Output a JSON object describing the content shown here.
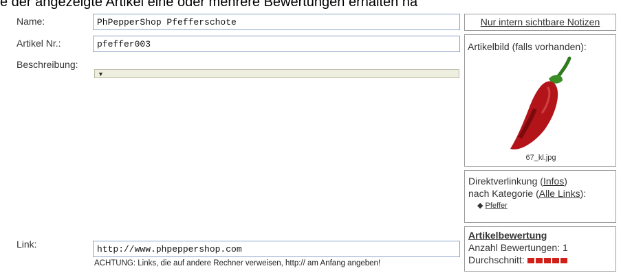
{
  "header": {
    "background_text": "e der angezeigte Artikel eine oder mehrere Bewertungen erhalten ha"
  },
  "form": {
    "name_label": "Name:",
    "name_value": "PhPepperShop Pfefferschote",
    "article_no_label": "Artikel Nr.:",
    "article_no_value": "pfeffer003",
    "description_label": "Beschreibung:",
    "link_label": "Link:",
    "link_value": "http://www.phpeppershop.com",
    "link_warning": "ACHTUNG: Links, die auf andere Rechner verweisen, http:// am Anfang angeben!"
  },
  "sidebar": {
    "notes_button": "Nur intern sichtbare Notizen",
    "image_title": "Artikelbild (falls vorhanden):",
    "image_filename": "67_kl.jpg",
    "deeplink": {
      "line1_prefix": "Direktverlinkung (",
      "infos": "Infos",
      "line1_suffix": ")",
      "line2_prefix": "nach Kategorie (",
      "all_links": "Alle Links",
      "line2_suffix": "):",
      "category": "Pfeffer"
    },
    "rating": {
      "title": "Artikelbewertung",
      "count_text": "Anzahl Bewertungen: 1",
      "avg_label": "Durchschnitt:",
      "avg_value": 5,
      "avg_max": 5,
      "color": "#d0201a"
    }
  }
}
